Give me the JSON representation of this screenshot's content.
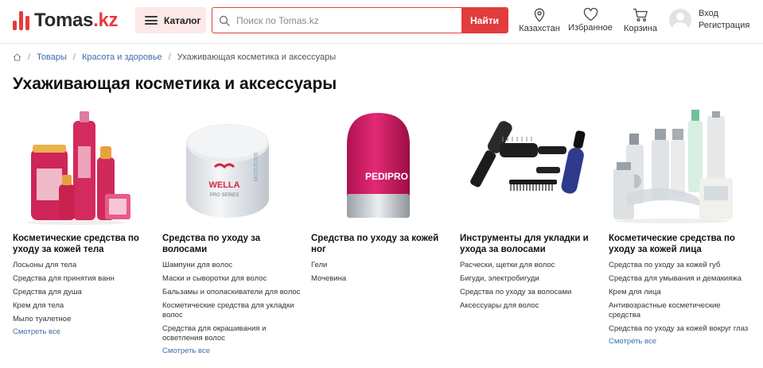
{
  "header": {
    "logo": {
      "name": "Tomas",
      "tld": ".kz",
      "brand_color": "#e73b3b"
    },
    "catalog_label": "Каталог",
    "search": {
      "placeholder": "Поиск по Tomas.kz",
      "value": "",
      "button_label": "Найти"
    },
    "location_label": "Казахстан",
    "favorites_label": "Избранное",
    "cart_label": "Корзина",
    "login_label": "Вход",
    "register_label": "Регистрация"
  },
  "breadcrumbs": [
    "Товары",
    "Красота и здоровье",
    "Ухаживающая косметика и аксессуары"
  ],
  "page_title": "Ухаживающая косметика и аксессуары",
  "categories": [
    {
      "title": "Косметические средства по уходу за кожей тела",
      "items": [
        "Лосьоны для тела",
        "Средства для принятия ванн",
        "Средства для душа",
        "Крем для тела",
        "Мыло туалетное"
      ],
      "see_all": "Смотреть все"
    },
    {
      "title": "Средства по уходу за волосами",
      "items": [
        "Шампуни для волос",
        "Маски и сыворотки для волос",
        "Бальзамы и ополаскиватели для волос",
        "Косметические средства для укладки волос",
        "Средства для окрашивания и осветления волос"
      ],
      "see_all": "Смотреть все",
      "product_label": [
        "WELLA",
        "PRO SERIES",
        "MOISTURE"
      ]
    },
    {
      "title": "Средства по уходу за кожей ног",
      "items": [
        "Гели",
        "Мочевина"
      ],
      "product_label": [
        "PEDIPRO"
      ]
    },
    {
      "title": "Инструменты для укладки и ухода за волосами",
      "items": [
        "Расчески, щетки для волос",
        "Бигуди, электробигуди",
        "Средства по уходу за волосами",
        "Аксессуары для волос"
      ]
    },
    {
      "title": "Косметические средства по уходу за кожей лица",
      "items": [
        "Средства по уходу за кожей губ",
        "Средства для умывания и демакияжа",
        "Крем для лица",
        "Антивозрастные косметические средства",
        "Средства по уходу за кожей вокруг глаз"
      ],
      "see_all": "Смотреть все"
    }
  ],
  "colors": {
    "accent": "#e23c3c",
    "link": "#3b6ea8",
    "catalog_bg": "#fde8e8"
  }
}
